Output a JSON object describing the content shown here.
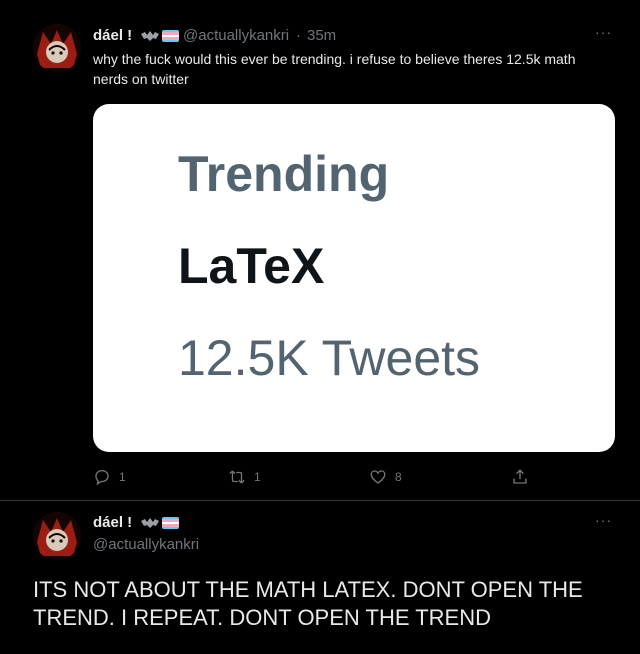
{
  "tweet": {
    "display_name": "dáel !",
    "handle": "@actuallykankri",
    "separator": "·",
    "time": "35m",
    "more": "···",
    "text": "why the fuck would this ever be trending. i refuse to believe theres 12.5k math nerds on twitter",
    "image": {
      "heading": "Trending",
      "topic": "LaTeX",
      "count": "12.5K Tweets"
    },
    "actions": {
      "replies": "1",
      "retweets": "1",
      "likes": "8"
    }
  },
  "reply": {
    "display_name": "dáel !",
    "handle": "@actuallykankri",
    "more": "···",
    "text": "ITS NOT ABOUT THE MATH LATEX. DONT OPEN THE TREND. I REPEAT. DONT OPEN THE TREND"
  },
  "colors": {
    "background": "#000000",
    "text": "#e7e9ea",
    "secondary": "#71767b",
    "flag_blue": "#5bcefa",
    "flag_pink": "#f5a9b8",
    "flag_white": "#ffffff"
  }
}
